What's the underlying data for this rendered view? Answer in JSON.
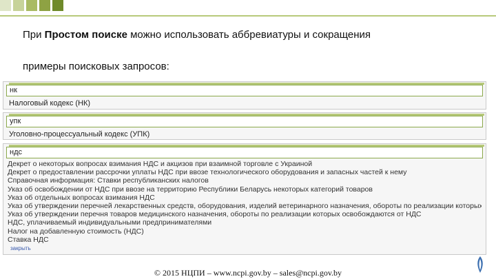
{
  "decor": {
    "square_colors": [
      "#dfe6c8",
      "#c7d39a",
      "#a9bb63",
      "#8ea243",
      "#6f8a2a"
    ]
  },
  "intro": {
    "prefix": "При ",
    "bold": "Простом поиске",
    "suffix": " можно использовать аббревиатуры и сокращения"
  },
  "subtitle": "примеры поисковых запросов:",
  "examples": [
    {
      "query": "нк",
      "result": "Налоговый кодекс (НК)"
    },
    {
      "query": "упк",
      "result": "Уголовно-процессуальный кодекс (УПК)"
    }
  ],
  "nds_panel": {
    "query": "ндс",
    "results": [
      "Декрет о некоторых вопросах взимания НДС и акцизов при взаимной торговле с Украиной",
      "Декрет о предоставлении рассрочки уплаты НДС при ввозе технологического оборудования и запасных частей к нему",
      "Справочная информация: Ставки республиканских налогов",
      "Указ об освобождении  от НДС при ввозе на территорию Республики Беларусь некоторых категорий товаров",
      "Указ об отдельных вопросах взимания НДС",
      "Указ об утверждении перечней лекарственных средств, оборудования, изделий ветеринарного назначения, обороты по реализации которых",
      "Указ об утверждении перечня товаров медицинского назначения, обороты по реализации которых  освобождаются от НДС",
      "НДС, уплачиваемый индивидуальными предпринимателями",
      "Налог на добавленную стоимость (НДС)",
      "Ставка НДС"
    ],
    "more_label": "закрыть"
  },
  "footer": "© 2015 НЦПИ – www.ncpi.gov.by – sales@ncpi.gov.by"
}
